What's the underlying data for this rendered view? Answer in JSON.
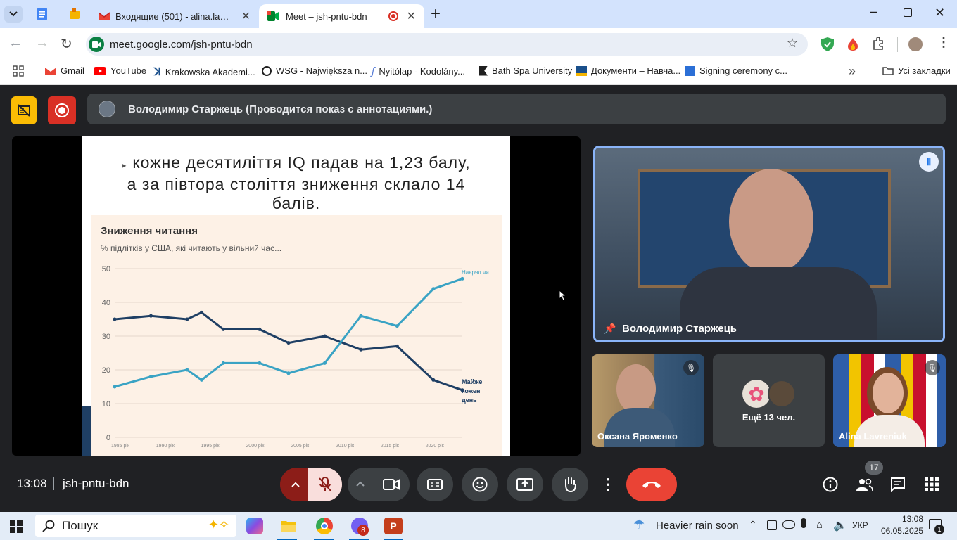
{
  "tabs": [
    {
      "title": ""
    },
    {
      "title": "Входящие (501) - alina.lavreniuk"
    },
    {
      "title": "Meet – jsh-pntu-bdn"
    }
  ],
  "address": {
    "url": "meet.google.com/jsh-pntu-bdn"
  },
  "bookmarks": {
    "items": [
      {
        "label": "Gmail"
      },
      {
        "label": "YouTube"
      },
      {
        "label": "Krakowska Akademi..."
      },
      {
        "label": "WSG - Największa n..."
      },
      {
        "label": "Nyitólap - Kodolány..."
      },
      {
        "label": "Bath Spa University"
      },
      {
        "label": "Документи – Навча..."
      },
      {
        "label": "Signing ceremony c..."
      }
    ],
    "all_label": "Усі закладки"
  },
  "meet": {
    "presenter_text": "Володимир Старжець (Проводится показ с аннотациями.)",
    "slide": {
      "line1": "кожне десятиліття IQ падав на 1,23 балу,",
      "line2": "а за півтора століття зниження склало 14",
      "line3": "балів."
    },
    "main_speaker": "Володимир Старжець",
    "participants": [
      {
        "name": "Оксана Яроменко"
      },
      {
        "name": "Ещё 13 чел."
      },
      {
        "name": "Alina Lavreniuk"
      }
    ],
    "time": "13:08",
    "meeting_code": "jsh-pntu-bdn",
    "participant_count": "17"
  },
  "chart_data": {
    "type": "line",
    "title": "Зниження читання",
    "subtitle": "% підлітків у США, які читають у вільний час...",
    "x": [
      "1985 рік",
      "1990 рік",
      "1995 рік",
      "2000 рік",
      "2005 рік",
      "2010 рік",
      "2015 рік",
      "2020 рік"
    ],
    "x_years": [
      1984,
      1989,
      1991,
      1994,
      1996,
      1999,
      2004,
      2009,
      2014,
      2019
    ],
    "ylim": [
      0,
      50
    ],
    "yticks": [
      0,
      10,
      20,
      30,
      40,
      50
    ],
    "series": [
      {
        "name": "Майже кожен день",
        "color": "#1f3f64",
        "points": [
          [
            1984,
            35
          ],
          [
            1989,
            36
          ],
          [
            1994,
            35
          ],
          [
            1996,
            37
          ],
          [
            1999,
            32
          ],
          [
            2004,
            32
          ],
          [
            2008,
            28
          ],
          [
            2013,
            30
          ],
          [
            2018,
            26
          ],
          [
            2023,
            27
          ],
          [
            2028,
            17
          ],
          [
            2032,
            14
          ]
        ]
      },
      {
        "name": "Навряд чи",
        "color": "#3aa3c4",
        "points": [
          [
            1984,
            15
          ],
          [
            1989,
            18
          ],
          [
            1994,
            20
          ],
          [
            1996,
            17
          ],
          [
            1999,
            22
          ],
          [
            2004,
            22
          ],
          [
            2008,
            19
          ],
          [
            2013,
            22
          ],
          [
            2018,
            36
          ],
          [
            2023,
            33
          ],
          [
            2028,
            44
          ],
          [
            2032,
            47
          ]
        ]
      }
    ],
    "series_labels": {
      "a": "Майже",
      "b": "кожен",
      "c": "день",
      "d": "Навряд чи"
    }
  },
  "taskbar": {
    "search": "Пошук",
    "weather": "Heavier rain soon",
    "lang": "УКР",
    "clock_time": "13:08",
    "clock_date": "06.05.2025",
    "viber_badge": "8"
  },
  "colors": {
    "meet_bg": "#202124",
    "hangup": "#ea4335",
    "accent": "#8ab4f8"
  }
}
